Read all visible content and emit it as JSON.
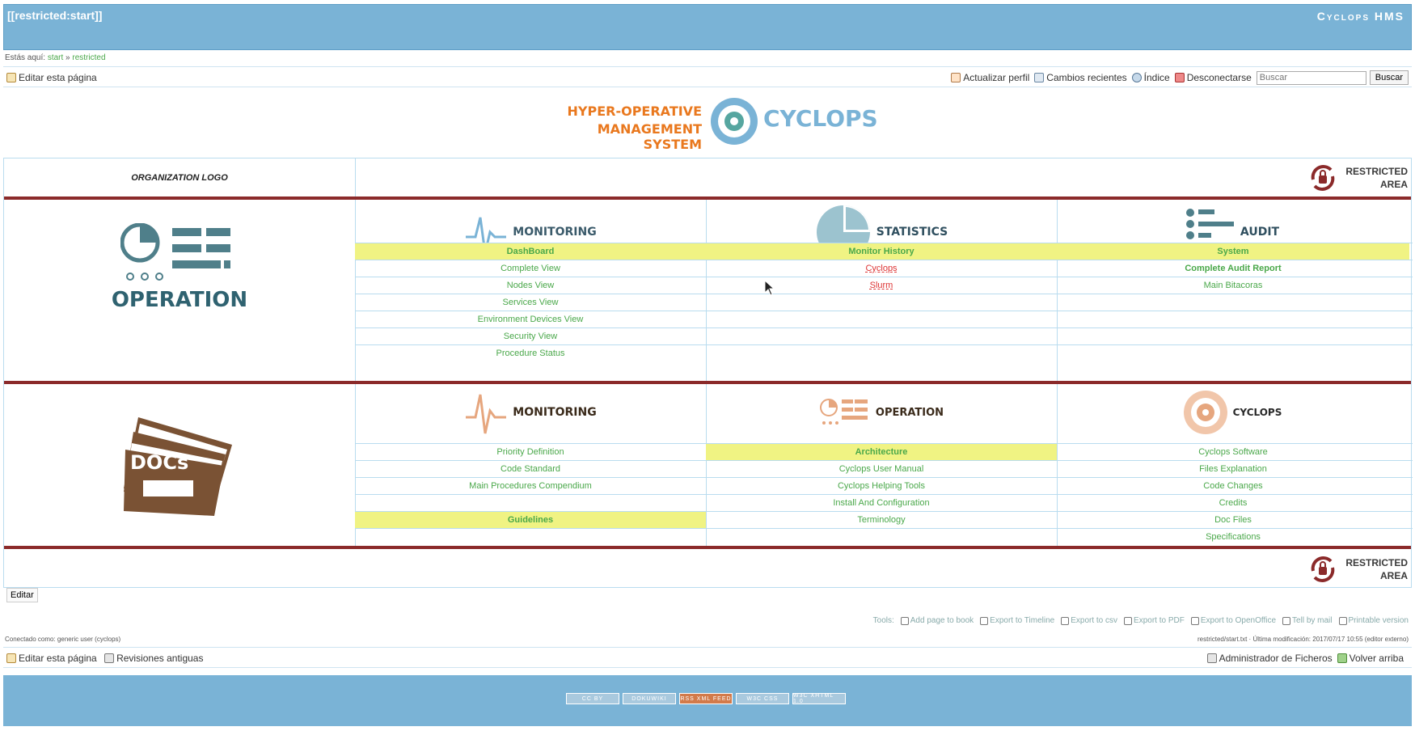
{
  "header": {
    "page_id": "[[restricted:start]]",
    "site_title": "Cyclops HMS"
  },
  "breadcrumb": {
    "prefix": "Estás aquí:",
    "start": "start",
    "separator": "»",
    "current": "restricted"
  },
  "top_bar": {
    "edit": "Editar esta página",
    "profile": "Actualizar perfil",
    "recent": "Cambios recientes",
    "index": "Índice",
    "logout": "Desconectarse",
    "search_placeholder": "Buscar",
    "search_button": "Buscar"
  },
  "hms_logo": {
    "line1": "HYPER-OPERATIVE",
    "line2": "MANAGEMENT SYSTEM",
    "word": "CYCLOPS"
  },
  "grid": {
    "org_logo": "ORGANIZATION LOGO",
    "restricted_line1": "RESTRICTED",
    "restricted_line2": "AREA",
    "op_label": "OPERATION",
    "docs_label": "DOCs",
    "sec1": {
      "monitoring": "MONITORING",
      "statistics": "STATISTICS",
      "audit": "AUDIT",
      "col1": [
        "DashBoard",
        "Complete View",
        "Nodes View",
        "Services View",
        "Environment Devices View",
        "Security View",
        "Procedure Status"
      ],
      "col2": [
        "Monitor History",
        "Cyclops",
        "Slurm"
      ],
      "col3": [
        "System",
        "Complete Audit Report",
        "Main Bitacoras"
      ]
    },
    "sec2": {
      "monitoring": "MONITORING",
      "operation": "OPERATION",
      "cyclops": "CYCLOPS",
      "col1": [
        "Priority Definition",
        "Code Standard",
        "Main Procedures Compendium",
        "",
        "Guidelines"
      ],
      "col2": [
        "Architecture",
        "Cyclops User Manual",
        "Cyclops Helping Tools",
        "Install And Configuration",
        "Terminology"
      ],
      "col3": [
        "Cyclops Software",
        "Files Explanation",
        "Code Changes",
        "Credits",
        "Doc Files",
        "Specifications"
      ]
    }
  },
  "edit_button": "Editar",
  "tools": {
    "label": "Tools:",
    "items": [
      "Add page to book",
      "Export to Timeline",
      "Export to csv",
      "Export to PDF",
      "Export to OpenOffice",
      "Tell by mail",
      "Printable version"
    ]
  },
  "status": {
    "connected": "Conectado como: generic user (cyclops)",
    "last_mod": "restricted/start.txt · Última modificación: 2017/07/17 10:55 (editor externo)"
  },
  "foot_bar": {
    "edit": "Editar esta página",
    "old_revisions": "Revisiones antiguas",
    "file_manager": "Administrador de Ficheros",
    "back_top": "Volver arriba"
  },
  "footer": {
    "badges": [
      "CC BY",
      "DOKUWIKI",
      "RSS XML FEED",
      "W3C CSS",
      "W3C XHTML 1.0"
    ]
  },
  "colors": {
    "header_blue": "#7ab3d6",
    "dark_red": "#8b2a2a",
    "highlight": "#f0f383",
    "link_green": "#4aa84a",
    "teal": "#4f7f8a",
    "brown": "#7a5234",
    "orange": "#e9781e"
  }
}
